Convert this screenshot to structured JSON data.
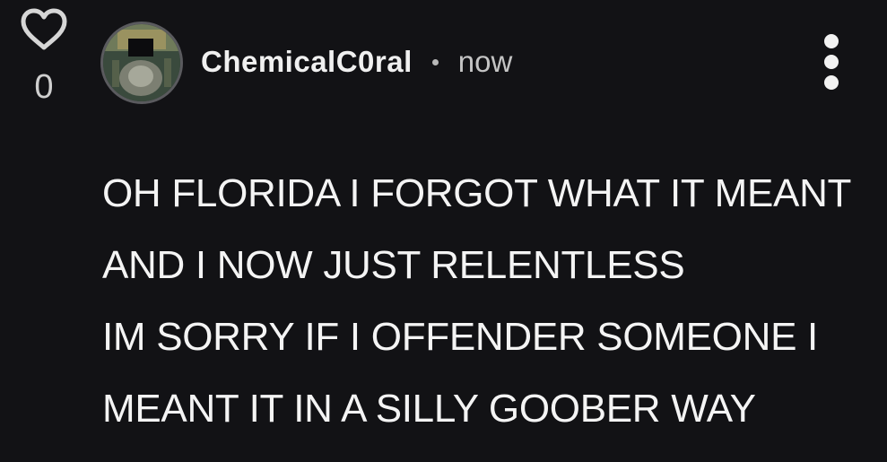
{
  "vote": {
    "count": "0",
    "icon": "heart-outline-icon"
  },
  "author": {
    "username": "ChemicalC0ral",
    "avatar_icon": "user-avatar",
    "separator": "•",
    "timestamp": "now"
  },
  "menu": {
    "icon": "more-vertical-icon"
  },
  "comment": {
    "lines": [
      "OH FLORIDA I FORGOT WHAT IT MEANT",
      "AND I NOW JUST RELENTLESS",
      "IM SORRY IF I OFFENDER SOMEONE I",
      "MEANT IT IN A SILLY GOOBER WAY"
    ]
  },
  "colors": {
    "background": "#121215",
    "text": "#f4f4f4",
    "muted": "#c4c4c4"
  }
}
